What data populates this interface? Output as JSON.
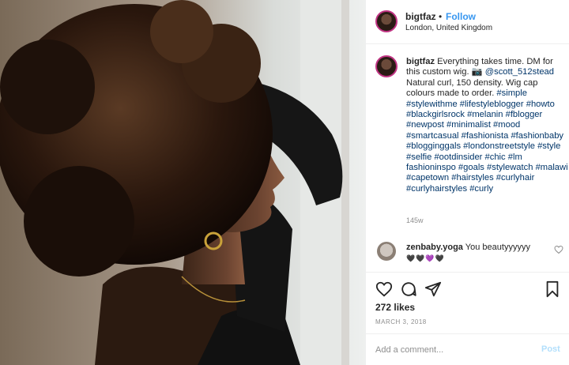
{
  "header": {
    "username": "bigtfaz",
    "dot": "•",
    "follow_label": "Follow",
    "location": "London, United Kingdom"
  },
  "caption": {
    "username": "bigtfaz",
    "text_part1": "Everything takes time. DM for this custom wig.",
    "emoji": "📷",
    "mention": "@scott_512stead",
    "text_part2": "Natural curl, 150 density. Wig cap colours made to order.",
    "hashtags": "#simple #stylewithme #lifestyleblogger #howto #blackgirlsrock #melanin #fblogger #newpost #minimalist #mood #smartcasual #fashionista #fashionbaby #blogginggals #londonstreetstyle #style #selfie #ootdinsider #chic #lm fashioninspo #goals #stylewatch #malawi #capetown #hairstyles #curlyhair #curlyhairstyles #curly",
    "time_ago": "145w"
  },
  "comment": {
    "username": "zenbaby.yoga",
    "text": "You beautyyyyyy",
    "emoji": "🖤🖤💜🖤"
  },
  "actions": {
    "icons": [
      "heart-icon",
      "comment-icon",
      "share-icon",
      "bookmark-icon"
    ]
  },
  "likes": "272 likes",
  "date": "MARCH 3, 2018",
  "add_comment": {
    "placeholder": "Add a comment...",
    "post_label": "Post"
  },
  "colors": {
    "link": "#3897f0",
    "hashtag": "#003569",
    "muted": "#8e8e8e",
    "post_disabled": "#b2dffc"
  }
}
